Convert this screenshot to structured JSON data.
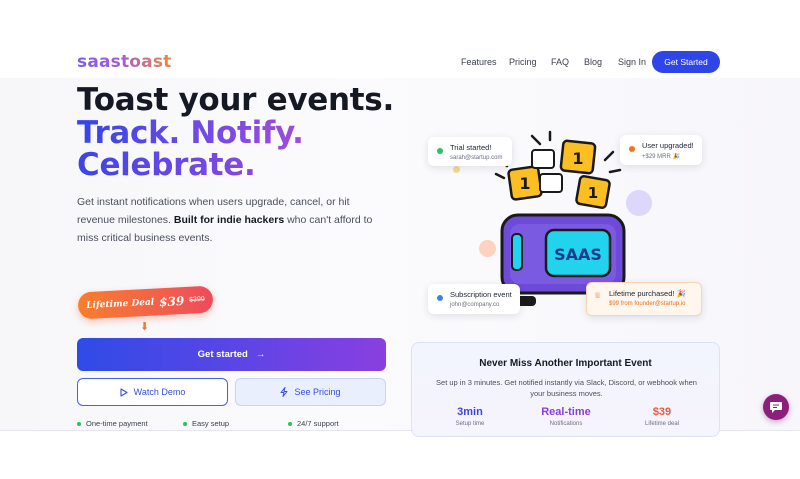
{
  "nav": {
    "logo": "saastoast",
    "links": [
      "Features",
      "Pricing",
      "FAQ",
      "Blog",
      "Sign In"
    ],
    "cta": "Get Started"
  },
  "hero": {
    "line1": "Toast your events.",
    "line2": "Track. Notify.",
    "line3": "Celebrate.",
    "desc_pre": "Get instant notifications when users upgrade, cancel, or hit revenue milestones. ",
    "desc_bold": "Built for indie hackers",
    "desc_post": " who can't afford to miss critical business events."
  },
  "deal": {
    "label": "Lifetime Deal",
    "price": "$39",
    "old_price": "$399"
  },
  "buttons": {
    "primary": "Get started",
    "demo": "Watch Demo",
    "pricing": "See Pricing"
  },
  "features": [
    "One-time payment",
    "Easy setup",
    "24/7 support"
  ],
  "cards": [
    {
      "title": "Trial started!",
      "sub": "sarah@startup.com",
      "dot": "#22c55e"
    },
    {
      "title": "User upgraded!",
      "sub": "+$29 MRR 🎉",
      "dot": "#f97316"
    },
    {
      "title": "Subscription event",
      "sub": "john@company.co",
      "dot": "#3b82f6"
    },
    {
      "title": "Lifetime purchased! 🎉",
      "sub": "$99 from founder@startup.io"
    }
  ],
  "illustration": {
    "toaster_label": "SAAS",
    "badge_number": "1"
  },
  "panel": {
    "title": "Never Miss Another Important Event",
    "subtitle": "Set up in 3 minutes. Get notified instantly via Slack, Discord, or webhook when your business moves.",
    "stats": [
      {
        "value": "3min",
        "label": "Setup time",
        "color": "#3b46e6"
      },
      {
        "value": "Real-time",
        "label": "Notifications",
        "color": "#8a3fd8"
      },
      {
        "value": "$39",
        "label": "Lifetime deal",
        "color": "#ee5a3c"
      }
    ]
  },
  "colors": {
    "brand_blue": "#2f45e8",
    "brand_purple": "#8a3fe0",
    "deal_orange": "#f97e2c",
    "chat_bubble": "#8b1f7a"
  }
}
